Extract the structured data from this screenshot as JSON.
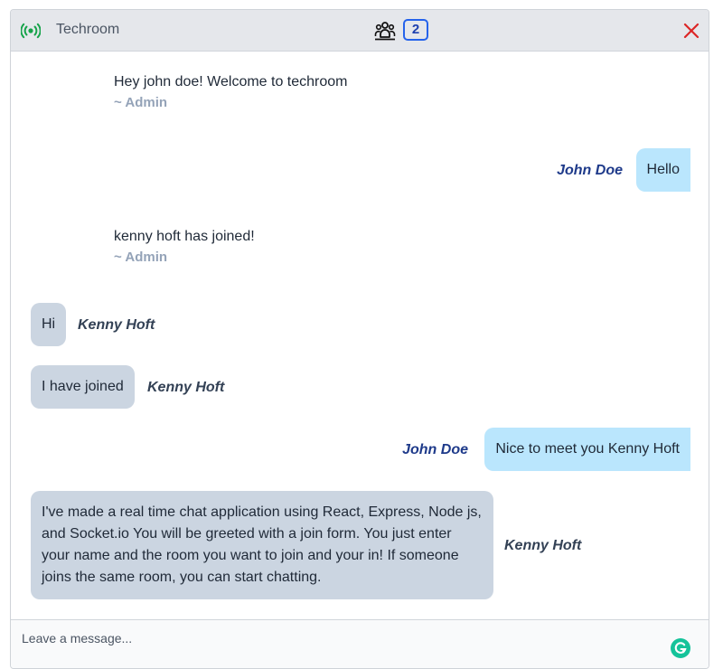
{
  "header": {
    "room_name": "Techroom",
    "user_count": "2",
    "icons": {
      "status": "live-broadcast-icon",
      "users": "users-group-icon",
      "close": "close-icon"
    },
    "colors": {
      "status": "#16a34a",
      "close": "#dc2626",
      "badge": "#2563eb"
    }
  },
  "messages": [
    {
      "type": "admin",
      "text": "Hey john doe! Welcome to techroom",
      "sender": "~ Admin"
    },
    {
      "type": "me",
      "sender": "John Doe",
      "text": "Hello"
    },
    {
      "type": "admin",
      "text": "kenny hoft has joined!",
      "sender": "~ Admin"
    },
    {
      "type": "other",
      "sender": "Kenny Hoft",
      "text": "Hi"
    },
    {
      "type": "other",
      "sender": "Kenny Hoft",
      "text": "I have joined"
    },
    {
      "type": "me",
      "sender": "John Doe",
      "text": "Nice to meet you Kenny Hoft"
    },
    {
      "type": "other",
      "sender": "Kenny Hoft",
      "lines": [
        "I've made a real time chat application using React, Express, Node js,",
        "and Socket.io You will be greeted with a join form. You just enter",
        "your name and the room you want to join and your in! If someone",
        "joins the same room, you can start chatting."
      ]
    }
  ],
  "composer": {
    "placeholder": "Leave a message...",
    "value": "",
    "icon": "grammarly-icon"
  }
}
